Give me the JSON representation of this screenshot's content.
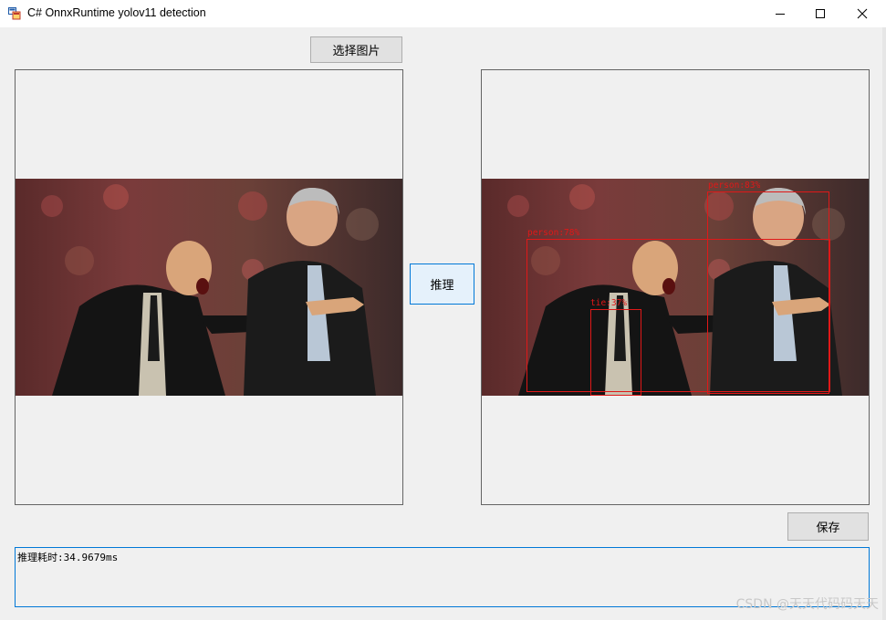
{
  "window": {
    "title": "C# OnnxRuntime yolov11 detection",
    "controls": [
      "minimize",
      "maximize",
      "close"
    ]
  },
  "buttons": {
    "select_image": "选择图片",
    "inference": "推理",
    "save": "保存"
  },
  "detections": [
    {
      "label": "person:83%"
    },
    {
      "label": "person:78%"
    },
    {
      "label": "tie:37%"
    }
  ],
  "log": {
    "text": "推理耗时:34.9679ms"
  },
  "watermark": "CSDN @天天代码码天天",
  "colors": {
    "detection": "#e01818",
    "focus_border": "#0078d7"
  }
}
